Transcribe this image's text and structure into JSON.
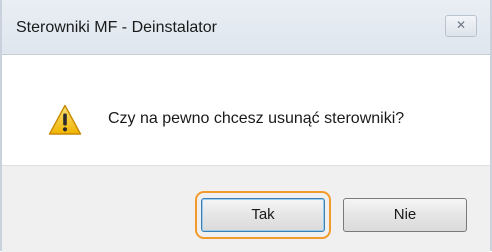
{
  "window": {
    "title": "Sterowniki MF - Deinstalator",
    "close_symbol": "✕"
  },
  "dialog": {
    "icon": "warning-icon",
    "message": "Czy na pewno chcesz usunąć sterowniki?"
  },
  "buttons": {
    "yes_label": "Tak",
    "no_label": "Nie"
  },
  "colors": {
    "focus_highlight": "#f39b2a",
    "warning_fill": "#f5c423"
  }
}
